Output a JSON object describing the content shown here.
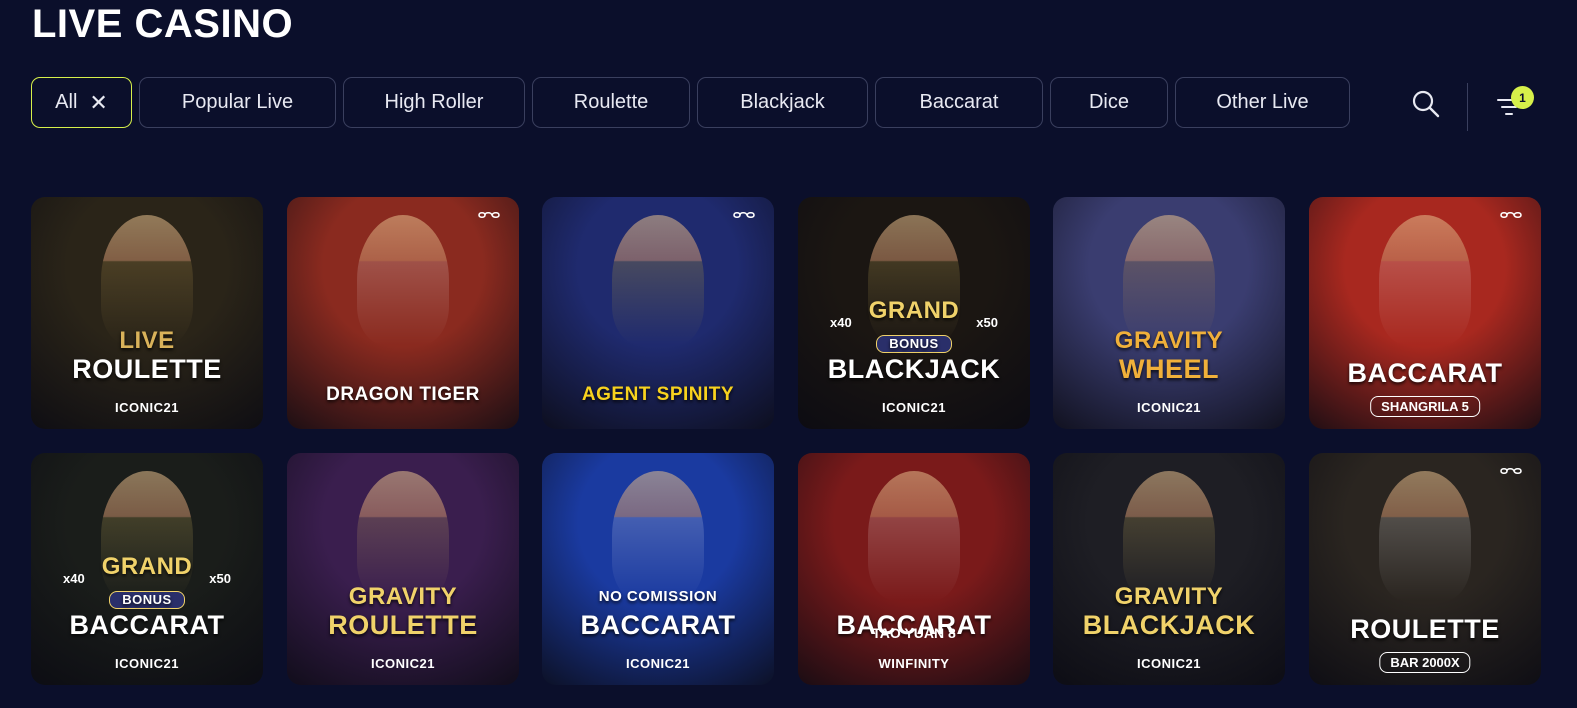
{
  "page": {
    "title": "LIVE CASINO"
  },
  "filters": [
    {
      "label": "All",
      "active": true
    },
    {
      "label": "Popular Live"
    },
    {
      "label": "High Roller"
    },
    {
      "label": "Roulette"
    },
    {
      "label": "Blackjack"
    },
    {
      "label": "Baccarat"
    },
    {
      "label": "Dice"
    },
    {
      "label": "Other Live"
    }
  ],
  "toolbar": {
    "search_icon": "search-icon",
    "filter_icon": "filter-icon",
    "filter_count": "1"
  },
  "games": [
    {
      "logo_top": "LIVE",
      "logo": "ROULETTE",
      "brand": "ICONIC21",
      "bg": "#2a2418",
      "accent": "#d9b25a"
    },
    {
      "logo": "DRAGON TIGER",
      "brand": "",
      "bg": "#8a2a1f",
      "accent": "#ffffff",
      "infinity": true
    },
    {
      "logo": "AGENT SPINITY",
      "brand": "",
      "bg": "#1f2a6e",
      "accent": "#f7d21e",
      "infinity": true
    },
    {
      "logo_top": "GRAND",
      "logo_mid": "BONUS",
      "logo": "BLACKJACK",
      "left_mult": "x40",
      "right_mult": "x50",
      "brand": "ICONIC21",
      "bg": "#1b1612",
      "accent": "#f0d26a"
    },
    {
      "logo_top": "GRAVITY",
      "logo": "WHEEL",
      "brand": "ICONIC21",
      "bg": "#3a3d70",
      "accent": "#f0b03a"
    },
    {
      "logo": "BACCARAT",
      "sub": "SHANGRILA 5",
      "brand": "",
      "bg": "#a8281f",
      "accent": "#ffffff",
      "infinity": true
    },
    {
      "logo_top": "GRAND",
      "logo_mid": "BONUS",
      "logo": "BACCARAT",
      "left_mult": "x40",
      "right_mult": "x50",
      "brand": "ICONIC21",
      "bg": "#1a1d1a",
      "accent": "#f0d26a"
    },
    {
      "logo_top": "GRAVITY",
      "logo": "ROULETTE",
      "brand": "ICONIC21",
      "bg": "#3a1e4e",
      "accent": "#f0d26a"
    },
    {
      "logo_top": "NO COMISSION",
      "logo": "BACCARAT",
      "brand": "ICONIC21",
      "bg": "#1a3aa0",
      "accent": "#ffffff"
    },
    {
      "logo": "BACCARAT",
      "sub": "TAO YUAN 8",
      "brand": "WINFINITY",
      "bg": "#7a1a1a",
      "accent": "#ffffff"
    },
    {
      "logo_top": "GRAVITY",
      "logo": "BLACKJACK",
      "brand": "ICONIC21",
      "bg": "#1e1e24",
      "accent": "#f0d26a"
    },
    {
      "logo": "ROULETTE",
      "sub": "BAR 2000X",
      "brand": "",
      "bg": "#2a2520",
      "accent": "#ffffff",
      "infinity": true
    }
  ]
}
